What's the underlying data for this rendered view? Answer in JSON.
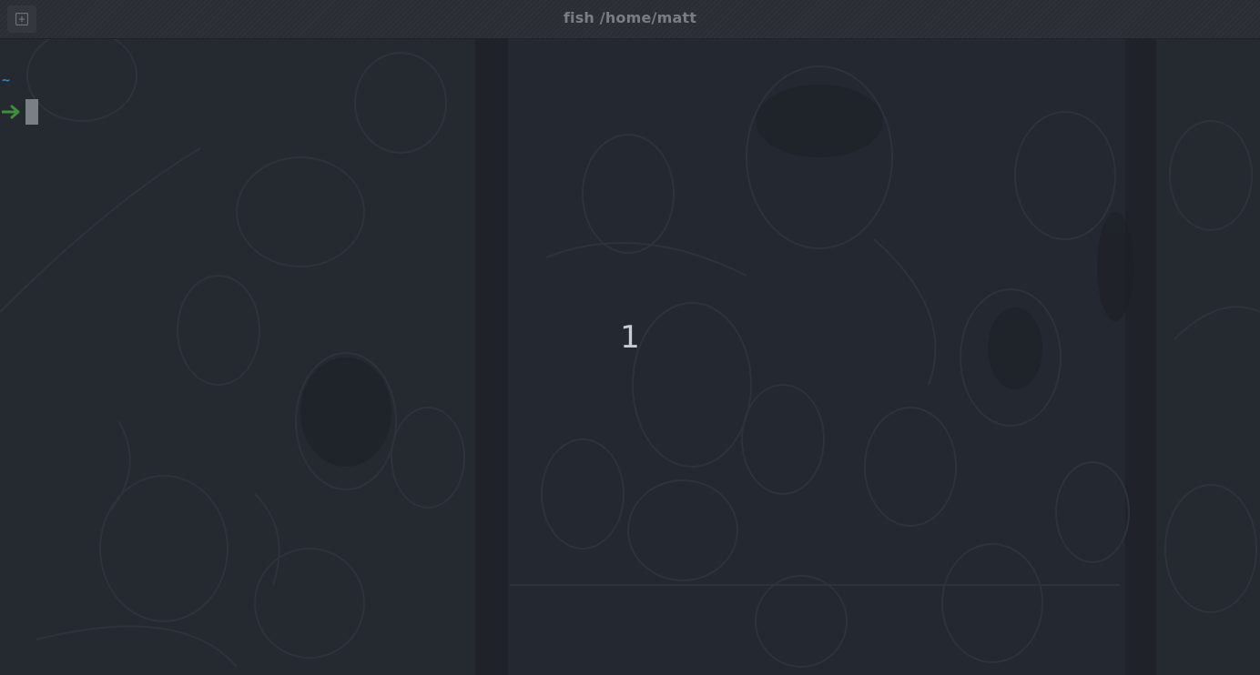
{
  "window": {
    "title": "fish /home/matt"
  },
  "titlebar": {
    "new_tab_icon": "new-tab-icon"
  },
  "terminal": {
    "cwd": "~",
    "prompt_icon": "arrow-right-icon",
    "cursor_icon": "block-cursor"
  },
  "overlay": {
    "workspace_number": "1"
  },
  "colors": {
    "background": "#23272e",
    "titlebar": "#2b2e34",
    "title_text": "#7a7d82",
    "cwd": "#3b7fb5",
    "prompt_arrow": "#3f8f3a",
    "cursor": "#8a8e94",
    "overlay_text": "#c9ccd0"
  }
}
